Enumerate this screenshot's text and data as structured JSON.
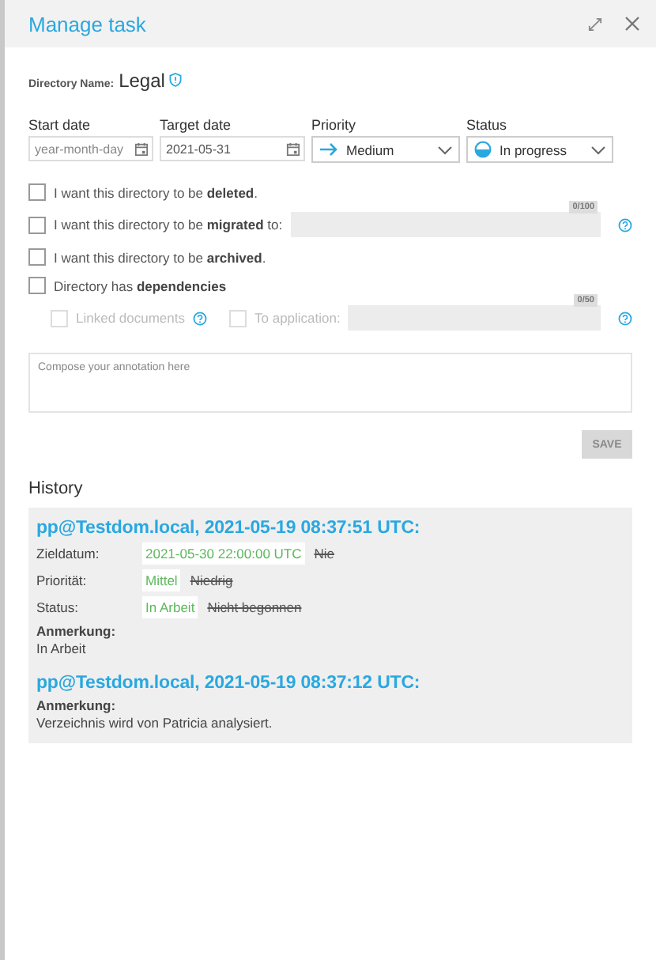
{
  "window": {
    "title": "Manage task"
  },
  "directory": {
    "label": "Directory Name:",
    "value": "Legal"
  },
  "fields": [
    {
      "kind": "date",
      "label": "Start date",
      "placeholder": "year-month-day"
    },
    {
      "kind": "date",
      "label": "Target date",
      "value": "2021-05-31"
    },
    {
      "kind": "priority",
      "label": "Priority",
      "value": "Medium"
    },
    {
      "kind": "status",
      "label": "Status",
      "value": "In progress"
    }
  ],
  "options": [
    {
      "kind": "check",
      "label": "I want this directory to be **deleted**.",
      "checked": false
    },
    {
      "kind": "field",
      "label": "I want this directory to be **migrated** to:",
      "checked": false,
      "counter": "0/100"
    },
    {
      "kind": "check",
      "label": "I want this directory to be **archived**.",
      "checked": false
    },
    {
      "kind": "check",
      "label": "Directory has **dependencies**",
      "checked": false
    }
  ],
  "dependencies": [
    {
      "kind": "check",
      "label": "Linked documents",
      "checked": false,
      "disabled": true
    },
    {
      "kind": "field",
      "label": "To application:",
      "checked": false,
      "disabled": true,
      "counter": "0/50"
    }
  ],
  "annotation": {
    "placeholder": "Compose your annotation here"
  },
  "save_button": {
    "label": "SAVE",
    "disabled": true
  },
  "history": {
    "title": "History",
    "entries": [
      {
        "header": "pp@Testdom.local, 2021-05-19 08:37:51 UTC:",
        "changes": [
          {
            "label": "Zieldatum:",
            "new": "2021-05-30 22:00:00 UTC",
            "old": "Nie"
          },
          {
            "label": "Priorität:",
            "new": "Mittel",
            "old": "Niedrig"
          },
          {
            "label": "Status:",
            "new": "In Arbeit",
            "old": "Nicht begonnen"
          }
        ],
        "note_label": "Anmerkung:",
        "note": "In Arbeit"
      },
      {
        "header": "pp@Testdom.local, 2021-05-19 08:37:12 UTC:",
        "note_label": "Anmerkung:",
        "note": "Verzeichnis wird von Patricia analysiert."
      }
    ]
  }
}
